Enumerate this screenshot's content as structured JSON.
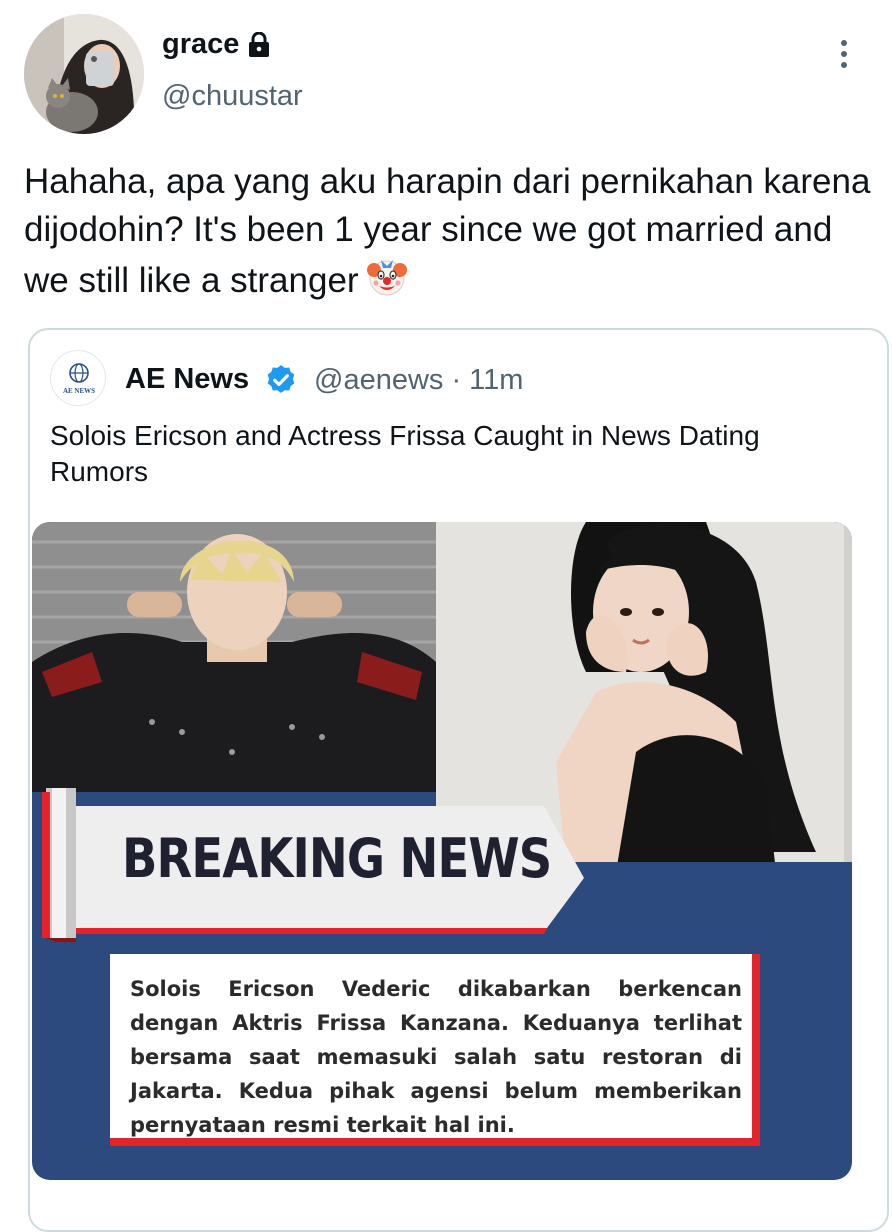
{
  "author": {
    "name": "grace",
    "handle": "@chuustar",
    "protected_icon": "lock-icon"
  },
  "tweet": {
    "text": "Hahaha, apa yang aku harapin dari pernikahan karena dijodohin? It's been 1 year since we got married and we still like a stranger",
    "emoji_icon": "clown-face-icon"
  },
  "quote": {
    "name": "AE News",
    "handle": "@aenews · 11m",
    "avatar_text": "AE NEWS",
    "verified_icon": "verified-badge-icon",
    "text": "Solois Ericson and Actress Frissa Caught in News Dating Rumors",
    "media": {
      "headline": "BREAKING NEWS",
      "body": "Solois Ericson Vederic dikabarkan berkencan dengan Aktris Frissa Kanzana. Keduanya terlihat bersama saat memasuki salah satu restoran di Jakarta. Kedua pihak agensi belum memberikan pernyataan resmi terkait hal ini."
    }
  },
  "colors": {
    "text": "#0f1419",
    "secondary": "#536471",
    "verified": "#1d9bf0",
    "banner_blue": "#2c4a7d",
    "banner_red": "#e4232b"
  }
}
